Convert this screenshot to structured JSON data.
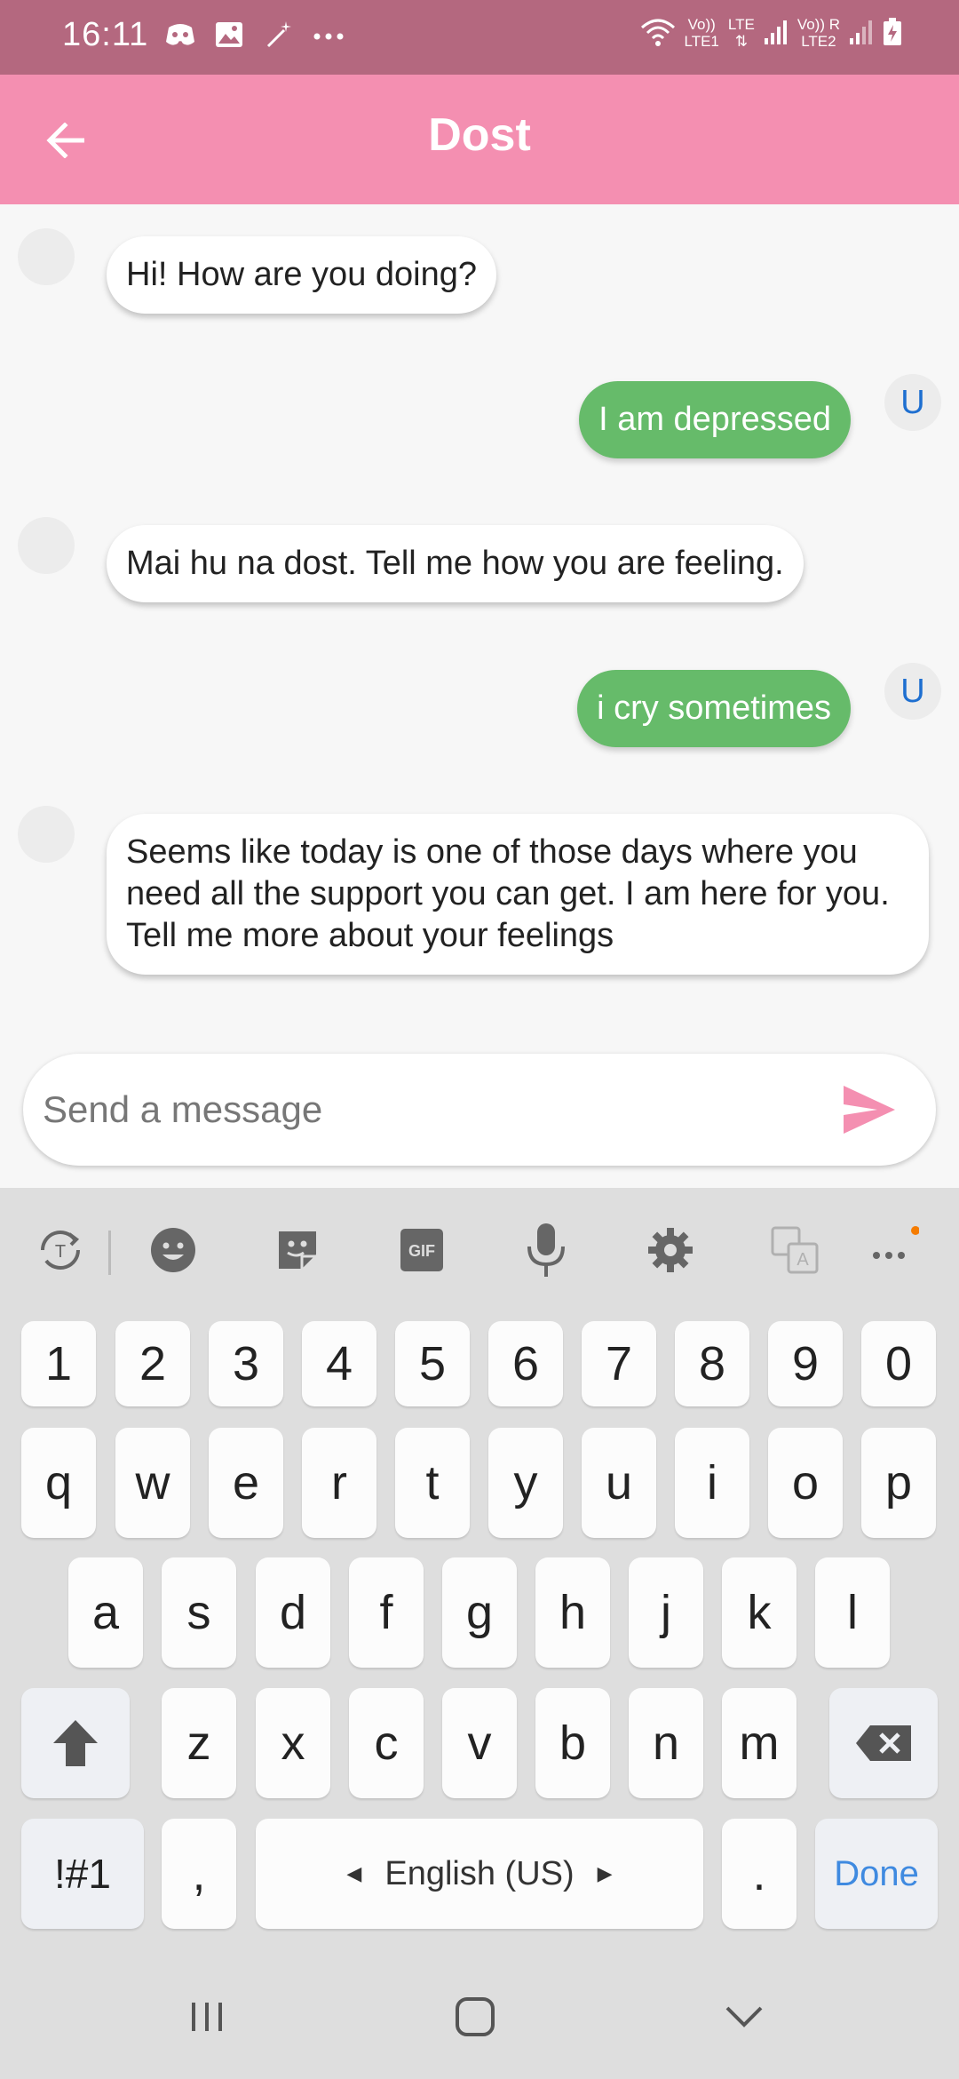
{
  "status_bar": {
    "time": "16:11",
    "net1_top": "Vo))",
    "net1_bottom": "LTE1",
    "lte_label": "LTE",
    "net2_top": "Vo)) R",
    "net2_bottom": "LTE2"
  },
  "app_bar": {
    "title": "Dost"
  },
  "messages": [
    {
      "sender": "bot",
      "text": "Hi! How are you doing?"
    },
    {
      "sender": "user",
      "text": "I am depressed",
      "avatar": "U"
    },
    {
      "sender": "bot",
      "text": "Mai hu na dost. Tell me how you are feeling."
    },
    {
      "sender": "user",
      "text": "i cry sometimes",
      "avatar": "U"
    },
    {
      "sender": "bot",
      "text": "Seems like today is one of those days where you need all the support you can get. I am here for you. Tell me more about your feelings"
    }
  ],
  "composer": {
    "placeholder": "Send a message",
    "value": ""
  },
  "keyboard": {
    "toolbar_icons": [
      "text-recognition-icon",
      "emoji-icon",
      "sticker-icon",
      "gif-icon",
      "microphone-icon",
      "gear-icon",
      "translate-icon",
      "more-icon"
    ],
    "gif_label": "GIF",
    "number_row": [
      "1",
      "2",
      "3",
      "4",
      "5",
      "6",
      "7",
      "8",
      "9",
      "0"
    ],
    "row1": [
      "q",
      "w",
      "e",
      "r",
      "t",
      "y",
      "u",
      "i",
      "o",
      "p"
    ],
    "row2": [
      "a",
      "s",
      "d",
      "f",
      "g",
      "h",
      "j",
      "k",
      "l"
    ],
    "row3": [
      "z",
      "x",
      "c",
      "v",
      "b",
      "n",
      "m"
    ],
    "symbols_label": "!#1",
    "comma_label": ",",
    "space_label": "English (US)",
    "period_label": ".",
    "done_label": "Done"
  },
  "colors": {
    "status_bar": "#b4687f",
    "app_bar": "#f48fb1",
    "user_bubble": "#66bb6a",
    "send_icon": "#f48fb1",
    "done_text": "#3f8ae0",
    "toolbar_dot": "#f57c00"
  }
}
